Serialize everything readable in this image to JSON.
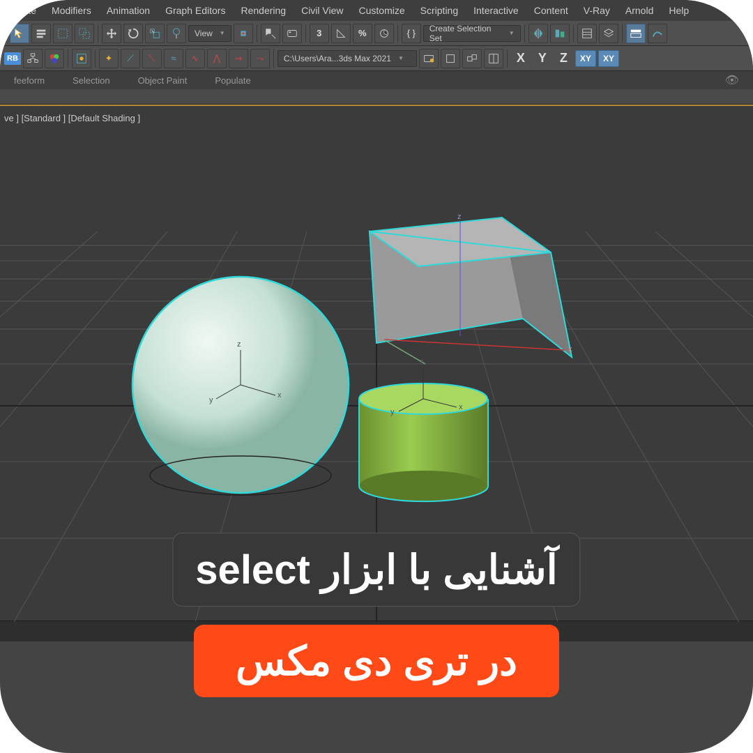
{
  "menu": {
    "items": [
      "Create",
      "Modifiers",
      "Animation",
      "Graph Editors",
      "Rendering",
      "Civil View",
      "Customize",
      "Scripting",
      "Interactive",
      "Content",
      "V-Ray",
      "Arnold",
      "Help"
    ]
  },
  "toolbar1": {
    "view_dropdown": "View",
    "selection_set": "Create Selection Set"
  },
  "toolbar2": {
    "path_dropdown": "C:\\Users\\Ara...3ds Max 2021",
    "rb_badge": "RB",
    "axes": [
      "X",
      "Y",
      "Z"
    ],
    "axis_buttons": [
      "XY",
      "XY"
    ]
  },
  "ribbon": {
    "tabs": [
      "feeform",
      "Selection",
      "Object Paint",
      "Populate"
    ]
  },
  "viewport": {
    "label": "ve ] [Standard ] [Default Shading ]",
    "gizmo_labels": {
      "x": "x",
      "y": "y",
      "z": "z"
    }
  },
  "caption": {
    "line1": "آشنایی با ابزار select",
    "line2": "در تری دی مکس"
  },
  "colors": {
    "accent_orange": "#ff4a17",
    "selection_cyan": "#2fd9d9",
    "sphere": "#cfe8dd",
    "box": "#9a9a9a",
    "cylinder": "#8fc040"
  }
}
